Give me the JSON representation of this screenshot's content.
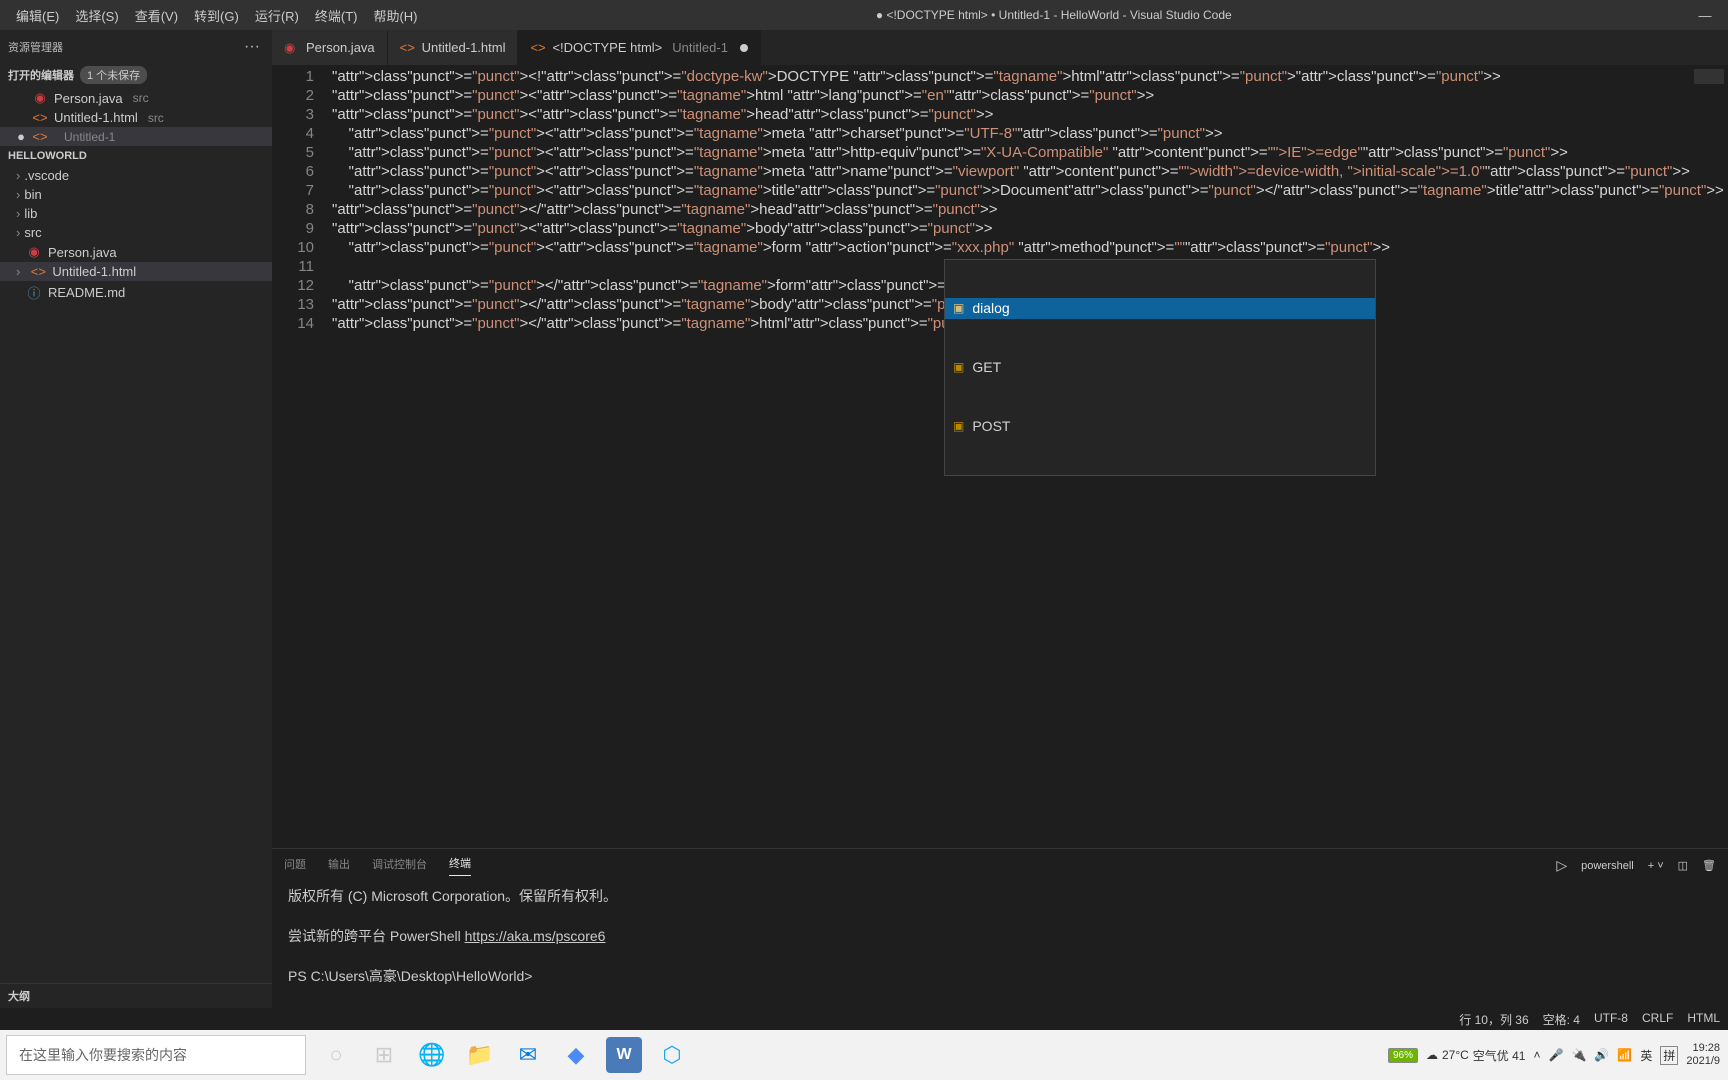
{
  "menubar": [
    "编辑(E)",
    "选择(S)",
    "查看(V)",
    "转到(G)",
    "运行(R)",
    "终端(T)",
    "帮助(H)"
  ],
  "window_title": "<!DOCTYPE html> • Untitled-1 - HelloWorld - Visual Studio Code",
  "sidebar": {
    "title": "资源管理器",
    "open_editors_label": "打开的编辑器",
    "unsaved_badge": "1 个未保存",
    "open_editors": [
      {
        "name": "Person.java",
        "path": "src",
        "icon": "java",
        "dirty": false
      },
      {
        "name": "Untitled-1.html",
        "path": "src",
        "icon": "html",
        "dirty": false
      },
      {
        "name": "<!DOCTYPE html>",
        "path": "Untitled-1",
        "icon": "html",
        "dirty": true
      }
    ],
    "workspace": "HELLOWORLD",
    "tree": [
      {
        "type": "folder",
        "name": ".vscode"
      },
      {
        "type": "folder",
        "name": "bin"
      },
      {
        "type": "folder",
        "name": "lib"
      },
      {
        "type": "folder",
        "name": "src"
      },
      {
        "type": "file",
        "name": "Person.java",
        "icon": "java"
      },
      {
        "type": "file",
        "name": "Untitled-1.html",
        "icon": "html",
        "active": true
      },
      {
        "type": "file",
        "name": "README.md",
        "icon": "md"
      }
    ],
    "outline": "大纲"
  },
  "tabs": [
    {
      "label": "Person.java",
      "icon": "java",
      "active": false,
      "dirty": false
    },
    {
      "label": "Untitled-1.html",
      "icon": "html",
      "active": false,
      "dirty": false
    },
    {
      "label": "<!DOCTYPE html>",
      "sublabel": "Untitled-1",
      "icon": "html",
      "active": true,
      "dirty": true
    }
  ],
  "code": {
    "lines": [
      "<!DOCTYPE html>",
      "<html lang=\"en\">",
      "<head>",
      "    <meta charset=\"UTF-8\">",
      "    <meta http-equiv=\"X-UA-Compatible\" content=\"IE=edge\">",
      "    <meta name=\"viewport\" content=\"width=device-width, initial-scale=1.0\">",
      "    <title>Document</title>",
      "</head>",
      "<body>",
      "    <form action=\"xxx.php\" method=\"\">",
      "",
      "    </form>",
      "</body>",
      "</html>"
    ],
    "cursor_line": 10,
    "cursor_col": 36
  },
  "suggest": {
    "items": [
      "dialog",
      "GET",
      "POST"
    ],
    "selected": 0
  },
  "panel": {
    "tabs": [
      "问题",
      "输出",
      "调试控制台",
      "终端"
    ],
    "active": 3,
    "shell_name": "powershell",
    "lines": [
      "版权所有 (C) Microsoft Corporation。保留所有权利。",
      "",
      "尝试新的跨平台 PowerShell https://aka.ms/pscore6",
      "",
      "PS C:\\Users\\高豪\\Desktop\\HelloWorld>"
    ]
  },
  "statusbar": {
    "cursor": "行 10，列 36",
    "spaces": "空格: 4",
    "encoding": "UTF-8",
    "eol": "CRLF",
    "lang": "HTML"
  },
  "taskbar": {
    "search_placeholder": "在这里输入你要搜索的内容",
    "battery": "96%",
    "weather_temp": "27°C",
    "weather_text": "空气优 41",
    "ime": "英",
    "ime2": "拼",
    "time": "19:28",
    "date": "2021/9"
  }
}
